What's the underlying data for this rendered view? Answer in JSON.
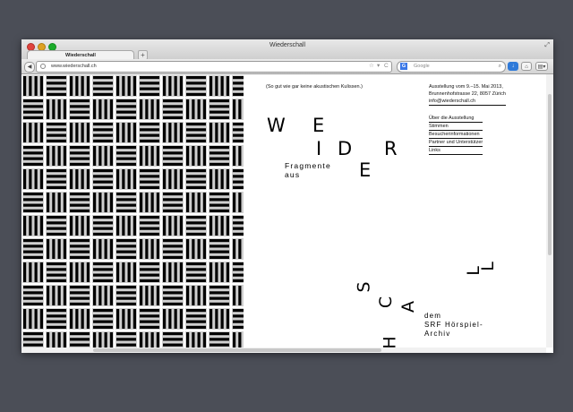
{
  "window": {
    "title": "Wiederschall"
  },
  "tab": {
    "label": "Wiederschall",
    "new_tab": "+"
  },
  "toolbar": {
    "url": "www.wiederschall.ch",
    "search_engine": "G",
    "search_placeholder": "Google",
    "back": "◀",
    "star": "☆",
    "dropdown": "▾",
    "reload": "C",
    "search_glyph": "⌕",
    "download": "↓",
    "home": "⌂",
    "menu": "▤▾",
    "resize": "⤢"
  },
  "page": {
    "intro": "(So gut wie gar keine akustischen Kulissen.)",
    "info": [
      "Ausstellung vom 9.–15. Mai 2013,",
      "Brunnenhofstrasse 22, 8057 Zürich",
      "info@wiederschall.ch"
    ],
    "nav": [
      "Über die Ausstellung",
      "Stimmen",
      "Besucherinformationen",
      "Partner und Unterstützer",
      "Links"
    ],
    "title_letters": [
      "W",
      "E",
      "I",
      "D",
      "R",
      "E",
      "S",
      "C",
      "H",
      "A",
      "L",
      "L"
    ],
    "subtitle_top": [
      "Fragmente",
      "aus"
    ],
    "subtitle_bottom": [
      "dem",
      "SRF Hörspiel-",
      "Archiv"
    ]
  },
  "colors": {
    "desktop": "#4b4e57",
    "pattern_dark": "#000000",
    "pattern_light": "#ffffff",
    "tile_gray": "#cfcfcf"
  }
}
